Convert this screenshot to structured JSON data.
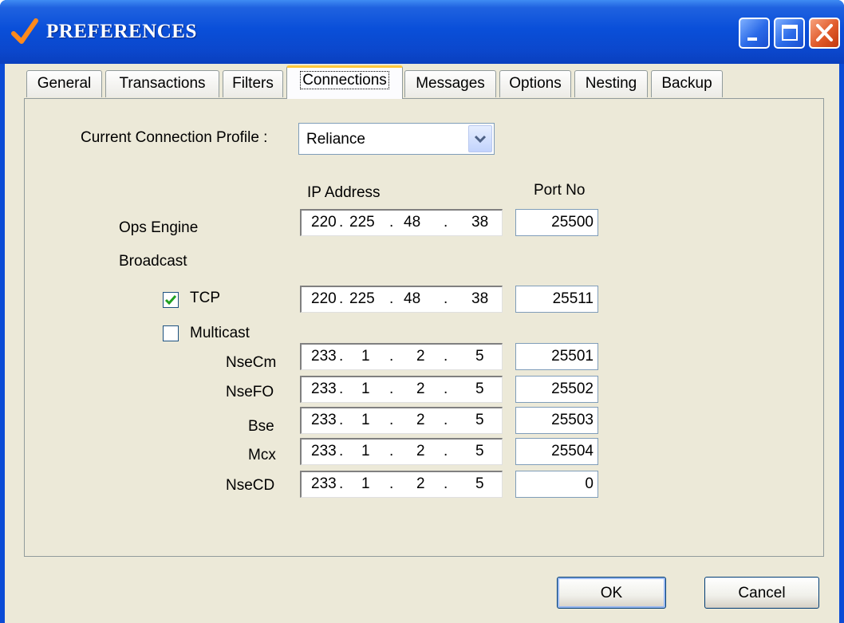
{
  "window": {
    "title": "PREFERENCES"
  },
  "tabs": [
    {
      "label": "General",
      "active": false
    },
    {
      "label": "Transactions",
      "active": false
    },
    {
      "label": "Filters",
      "active": false
    },
    {
      "label": "Connections",
      "active": true
    },
    {
      "label": "Messages",
      "active": false
    },
    {
      "label": "Options",
      "active": false
    },
    {
      "label": "Nesting",
      "active": false
    },
    {
      "label": "Backup",
      "active": false
    }
  ],
  "connections": {
    "profile_label": "Current Connection Profile :",
    "profile_value": "Reliance",
    "ip_header": "IP Address",
    "port_header": "Port No",
    "ops_engine": {
      "label": "Ops Engine",
      "ip": [
        "220",
        "225",
        "48",
        "38"
      ],
      "port": "25500"
    },
    "broadcast_label": "Broadcast",
    "tcp": {
      "label": "TCP",
      "checked": true,
      "ip": [
        "220",
        "225",
        "48",
        "38"
      ],
      "port": "25511"
    },
    "multicast": {
      "label": "Multicast",
      "checked": false
    },
    "multicast_rows": [
      {
        "label": "NseCm",
        "ip": [
          "233",
          "1",
          "2",
          "5"
        ],
        "port": "25501"
      },
      {
        "label": "NseFO",
        "ip": [
          "233",
          "1",
          "2",
          "5"
        ],
        "port": "25502"
      },
      {
        "label": "Bse",
        "ip": [
          "233",
          "1",
          "2",
          "5"
        ],
        "port": "25503"
      },
      {
        "label": "Mcx",
        "ip": [
          "233",
          "1",
          "2",
          "5"
        ],
        "port": "25504"
      },
      {
        "label": "NseCD",
        "ip": [
          "233",
          "1",
          "2",
          "5"
        ],
        "port": "0"
      }
    ]
  },
  "buttons": {
    "ok": "OK",
    "cancel": "Cancel"
  },
  "colors": {
    "titlebar": "#0a4fd9",
    "dialog_bg": "#ece9d8",
    "active_tab_accent": "#ffc83c",
    "check_color": "#21a121"
  }
}
